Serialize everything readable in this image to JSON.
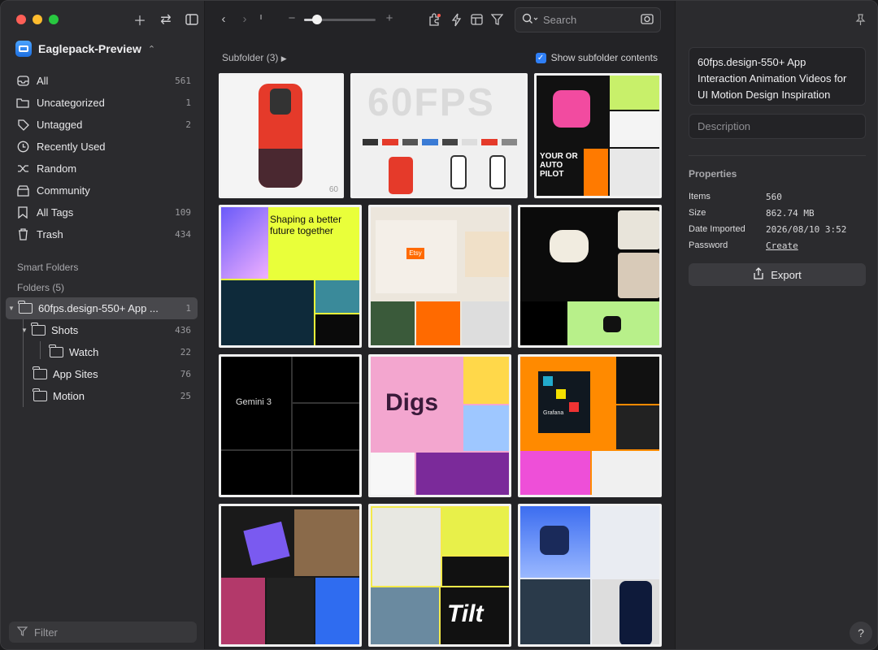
{
  "library": {
    "name": "Eaglepack-Preview"
  },
  "nav": [
    {
      "label": "All",
      "count": "561",
      "icon": "inbox-icon"
    },
    {
      "label": "Uncategorized",
      "count": "1",
      "icon": "folder-question-icon"
    },
    {
      "label": "Untagged",
      "count": "2",
      "icon": "tag-icon"
    },
    {
      "label": "Recently Used",
      "count": "",
      "icon": "clock-icon"
    },
    {
      "label": "Random",
      "count": "",
      "icon": "shuffle-icon"
    },
    {
      "label": "Community",
      "count": "",
      "icon": "community-icon"
    },
    {
      "label": "All Tags",
      "count": "109",
      "icon": "bookmark-icon"
    },
    {
      "label": "Trash",
      "count": "434",
      "icon": "trash-icon"
    }
  ],
  "sections": {
    "smart_folders": "Smart Folders",
    "folders": "Folders (5)"
  },
  "folders": [
    {
      "label": "60fps.design-550+ App ...",
      "count": "1"
    },
    {
      "label": "Shots",
      "count": "436"
    },
    {
      "label": "Watch",
      "count": "22"
    },
    {
      "label": "App Sites",
      "count": "76"
    },
    {
      "label": "Motion",
      "count": "25"
    }
  ],
  "filter": {
    "placeholder": "Filter"
  },
  "toolbar": {
    "search_placeholder": "Search"
  },
  "subbar": {
    "subfolder": "Subfolder (3)",
    "show_subfolder": "Show subfolder contents"
  },
  "tiles": [
    {
      "alt": "60 fps red phone shot",
      "text": "60",
      "bg": "#f4f4f4"
    },
    {
      "alt": "60FPS website screens",
      "text": "60FPS",
      "bg": "#f0f0f0"
    },
    {
      "alt": "Autopilot brand board",
      "text": "YOUR OR AUTO PILOT",
      "bg": "#111111"
    },
    {
      "alt": "Findest shaping a better future",
      "text": "Shaping a better future together",
      "bg": "#e9ff3a"
    },
    {
      "alt": "Etsy collage",
      "text": "Etsy",
      "bg": "#ece6dc"
    },
    {
      "alt": "Black logo app screens",
      "text": "",
      "bg": "#0b0b0b"
    },
    {
      "alt": "Gemini 3 dark screens",
      "text": "Gemini 3",
      "bg": "#000000"
    },
    {
      "alt": "Digs pink brand board",
      "text": "Digs",
      "bg": "#f3a6cf"
    },
    {
      "alt": "Orange grid poster",
      "text": "Grafana",
      "bg": "#ff8a00"
    },
    {
      "alt": "Postage stamps collage",
      "text": "",
      "bg": "#1a1a1a"
    },
    {
      "alt": "Tilt brand board",
      "text": "Tilt",
      "bg": "#f3e94a"
    },
    {
      "alt": "Blue app icon screens",
      "text": "",
      "bg": "#e9ecf2"
    }
  ],
  "panel": {
    "title": "60fps.design-550+ App Interaction Animation Videos for UI Motion Design Inspiration",
    "description_placeholder": "Description",
    "properties_title": "Properties",
    "props": [
      {
        "key": "Items",
        "value": "560"
      },
      {
        "key": "Size",
        "value": "862.74 MB"
      },
      {
        "key": "Date Imported",
        "value": "2026/08/10 3:52"
      },
      {
        "key": "Password",
        "value": "Create"
      }
    ],
    "export_label": "Export",
    "help_label": "?"
  }
}
